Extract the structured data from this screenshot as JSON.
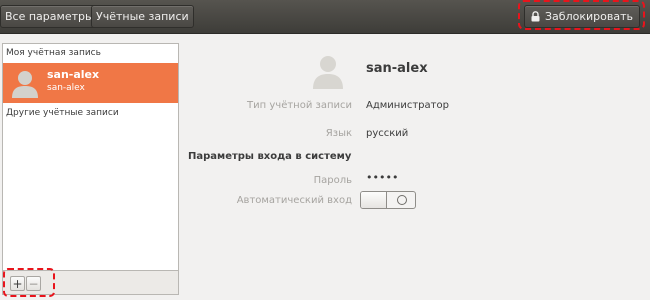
{
  "toolbar": {
    "all_settings_label": "Все параметры",
    "accounts_label": "Учётные записи",
    "lock_label": "Заблокировать"
  },
  "sidebar": {
    "my_account_header": "Моя учётная запись",
    "current_user": {
      "name": "san-alex",
      "login": "san-alex"
    },
    "other_accounts_header": "Другие учётные записи",
    "add_label": "+",
    "remove_label": "−"
  },
  "details": {
    "name": "san-alex",
    "account_type_label": "Тип учётной записи",
    "account_type_value": "Администратор",
    "language_label": "Язык",
    "language_value": "русский",
    "login_section_title": "Параметры входа в систему",
    "password_label": "Пароль",
    "password_value": "•••••",
    "auto_login_label": "Автоматический вход",
    "auto_login_enabled": false
  },
  "colors": {
    "selection": "#f07746",
    "highlight_dash": "#e8141c",
    "toolbar": "#4a4844"
  }
}
